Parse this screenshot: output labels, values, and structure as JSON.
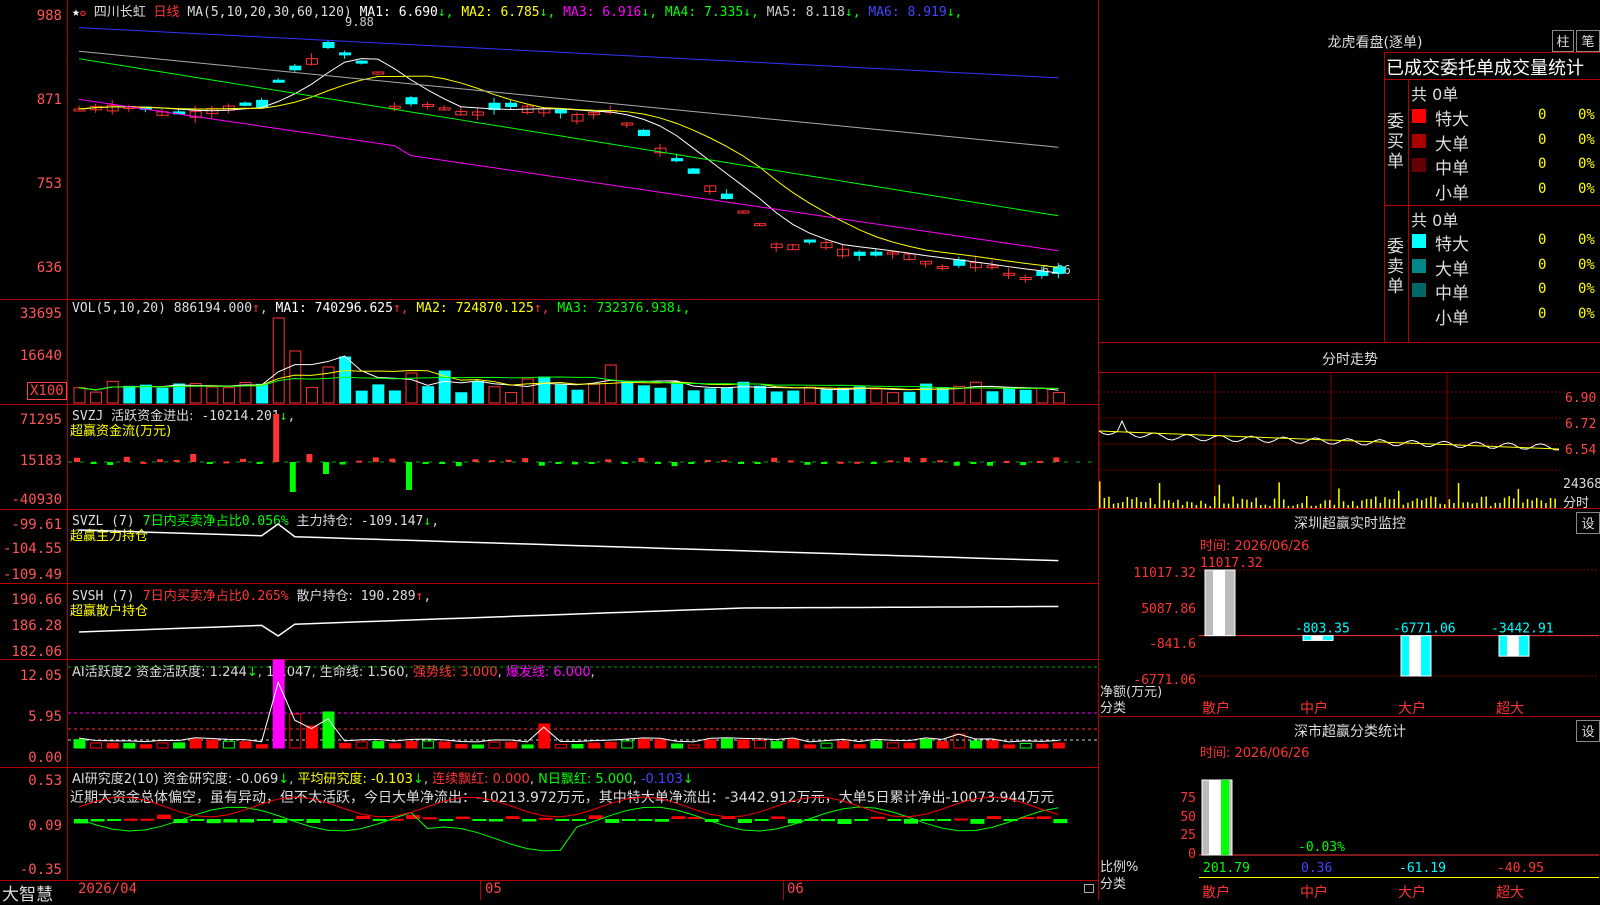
{
  "main": {
    "stock_name": "四川长虹",
    "period": "日线",
    "ma_header": "MA(5,10,20,30,60,120)",
    "ma": [
      {
        "label": "MA1:",
        "value": "6.690",
        "arrow": "↓",
        "color": "#ffffff"
      },
      {
        "label": "MA2:",
        "value": "6.785",
        "arrow": "↓",
        "color": "#ffff00"
      },
      {
        "label": "MA3:",
        "value": "6.916",
        "arrow": "↓",
        "color": "#ff00ff"
      },
      {
        "label": "MA4:",
        "value": "7.335",
        "arrow": "↓",
        "color": "#00ff00"
      },
      {
        "label": "MA5:",
        "value": "8.118",
        "arrow": "↓",
        "color": "#cccccc"
      },
      {
        "label": "MA6:",
        "value": "8.919",
        "arrow": "↓",
        "color": "#4444ff"
      }
    ],
    "y_ticks": [
      "988",
      "871",
      "753",
      "636"
    ],
    "high_label": "9.88",
    "low_label": "6.36",
    "x_ticks": [
      "2026/04",
      "05",
      "06"
    ]
  },
  "vol": {
    "header": "VOL(5,10,20)",
    "value": "886194.000",
    "ma": [
      {
        "label": "MA1:",
        "value": "740296.625",
        "arrow": "↑",
        "color": "#ffffff"
      },
      {
        "label": "MA2:",
        "value": "724870.125",
        "arrow": "↑",
        "color": "#ffff00"
      },
      {
        "label": "MA3:",
        "value": "732376.938",
        "arrow": "↓",
        "color": "#00ff00"
      }
    ],
    "y_ticks": [
      "33695",
      "16640"
    ],
    "unit": "X100"
  },
  "svzj": {
    "header": "SVZJ",
    "label": "活跃资金进出:",
    "value": "-10214.201",
    "arrow": "↓",
    "subtitle": "超赢资金流(万元)",
    "y_ticks": [
      "71295",
      "15183",
      "-40930"
    ]
  },
  "svzl": {
    "header": "SVZL (7)",
    "label1": "7日内买卖净占比",
    "value1": "0.056%",
    "label2": "主力持仓:",
    "value2": "-109.147",
    "arrow": "↓",
    "subtitle": "超赢主力持仓",
    "y_ticks": [
      "-99.61",
      "-104.55",
      "-109.49"
    ]
  },
  "svsh": {
    "header": "SVSH (7)",
    "label1": "7日内买卖净占比",
    "value1": "0.265%",
    "label2": "散户持仓:",
    "value2": "190.289",
    "arrow": "↑",
    "subtitle": "超赢散户持仓",
    "y_ticks": [
      "190.66",
      "186.28",
      "182.06"
    ]
  },
  "ai_active": {
    "header": "AI活跃度2",
    "label1": "资金活跃度:",
    "value1": "1.244",
    "value2": "12.047",
    "label3": "生命线:",
    "value3": "1.560",
    "label4": "强势线:",
    "value4": "3.000",
    "label5": "爆发线:",
    "value5": "6.000",
    "y_ticks": [
      "12.05",
      "5.95",
      "0.00"
    ]
  },
  "ai_research": {
    "header": "AI研究度2(10)",
    "label1": "资金研究度:",
    "value1": "-0.069",
    "label2": "平均研究度:",
    "value2": "-0.103",
    "label3": "连续飘红:",
    "value3": "0.000",
    "label4": "N日飘红:",
    "value4": "5.000",
    "value5": "-0.103",
    "comment": "近期大资金总体偏空，虽有异动，但不太活跃，今日大单净流出：-10213.972万元，其中特大单净流出：-3442.912万元，大单5日累计净出-10073.944万元",
    "y_ticks": [
      "0.53",
      "0.09",
      "-0.35"
    ]
  },
  "bottom": {
    "brand": "大智慧"
  },
  "right": {
    "dragon_title": "龙虎看盘(逐单)",
    "btn_zhu": "柱",
    "btn_bi": "笔",
    "stats_title": "已成交委托单成交量统计",
    "buy_header": "委买单",
    "buy_total": "共 0单",
    "sell_header": "委卖单",
    "sell_total": "共 0单",
    "buy_rows": [
      {
        "label": "特大",
        "count": "0",
        "pct": "0%",
        "color": "#ff0000"
      },
      {
        "label": "大单",
        "count": "0",
        "pct": "0%",
        "color": "#aa0000"
      },
      {
        "label": "中单",
        "count": "0",
        "pct": "0%",
        "color": "#660000"
      },
      {
        "label": "小单",
        "count": "0",
        "pct": "0%",
        "color": ""
      }
    ],
    "sell_rows": [
      {
        "label": "特大",
        "count": "0",
        "pct": "0%",
        "color": "#00ffff"
      },
      {
        "label": "大单",
        "count": "0",
        "pct": "0%",
        "color": "#008888"
      },
      {
        "label": "中单",
        "count": "0",
        "pct": "0%",
        "color": "#006666"
      },
      {
        "label": "小单",
        "count": "0",
        "pct": "0%",
        "color": ""
      }
    ],
    "intraday_title": "分时走势",
    "intraday_ticks": [
      "6.90",
      "6.72",
      "6.54"
    ],
    "intraday_vol": "24368",
    "intraday_vol_label": "分时",
    "sz_monitor_title": "深圳超赢实时监控",
    "sz_monitor_btn": "设",
    "monitor_time": "时间: 2026/06/26",
    "monitor_ticks": [
      "11017.32",
      "5087.86",
      "-841.6",
      "-6771.06"
    ],
    "monitor_top_label": "11017.32",
    "monitor_values": [
      {
        "cat": "散户",
        "value": 11017.32,
        "label": ""
      },
      {
        "cat": "中户",
        "value": -803.35,
        "label": "-803.35"
      },
      {
        "cat": "大户",
        "value": -6771.06,
        "label": "-6771.06"
      },
      {
        "cat": "超大",
        "value": -3442.91,
        "label": "-3442.91"
      }
    ],
    "monitor_unit": "净额(万元)",
    "monitor_unit2": "分类",
    "sz_class_title": "深市超赢分类统计",
    "sz_class_btn": "设",
    "class_time": "时间: 2026/06/26",
    "class_ticks": [
      "75",
      "50",
      "25",
      "0"
    ],
    "class_mid_label": "-0.03%",
    "class_values": [
      {
        "cat": "散户",
        "value": "201.79",
        "color": "#00ff00"
      },
      {
        "cat": "中户",
        "value": "0.36",
        "color": "#4444ff"
      },
      {
        "cat": "大户",
        "value": "-61.19",
        "color": "#00ffff"
      },
      {
        "cat": "超大",
        "value": "-40.95",
        "color": "#ff3333"
      }
    ],
    "class_unit": "比例%",
    "class_unit2": "分类"
  }
}
